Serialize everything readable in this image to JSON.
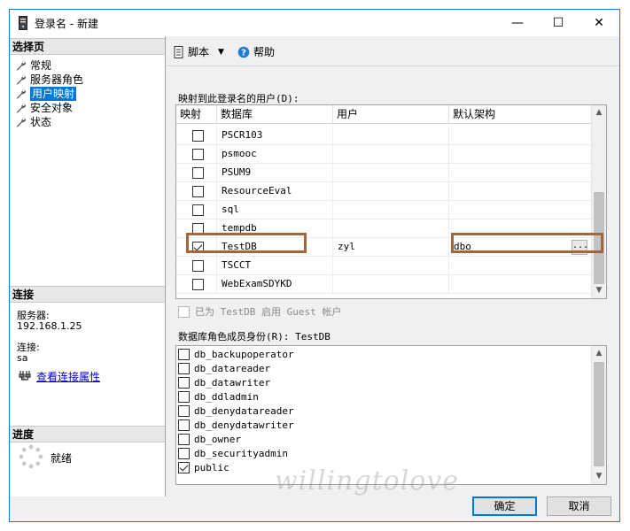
{
  "window": {
    "title": "登录名 - 新建",
    "minimize": "—",
    "maximize": "☐",
    "close": "✕"
  },
  "left_panel": {
    "select_page_header": "选择页",
    "nav_items": [
      {
        "label": "常规",
        "icon": "wrench-icon",
        "selected": false
      },
      {
        "label": "服务器角色",
        "icon": "wrench-icon",
        "selected": false
      },
      {
        "label": "用户映射",
        "icon": "wrench-icon",
        "selected": true
      },
      {
        "label": "安全对象",
        "icon": "wrench-icon",
        "selected": false
      },
      {
        "label": "状态",
        "icon": "wrench-icon",
        "selected": false
      }
    ],
    "connection_header": "连接",
    "server_label": "服务器:",
    "server_value": "192.168.1.25",
    "connection_label": "连接:",
    "connection_value": "sa",
    "view_link": "查看连接属性",
    "progress_header": "进度",
    "progress_status": "就绪"
  },
  "toolbar": {
    "script_label": "脚本",
    "help_label": "帮助"
  },
  "mapping": {
    "title": "映射到此登录名的用户(D):",
    "columns": [
      "映射",
      "数据库",
      "用户",
      "默认架构"
    ],
    "rows": [
      {
        "mapped": false,
        "database": "PSCR103",
        "user": "",
        "schema": ""
      },
      {
        "mapped": false,
        "database": "psmooc",
        "user": "",
        "schema": ""
      },
      {
        "mapped": false,
        "database": "PSUM9",
        "user": "",
        "schema": ""
      },
      {
        "mapped": false,
        "database": "ResourceEval",
        "user": "",
        "schema": ""
      },
      {
        "mapped": false,
        "database": "sql",
        "user": "",
        "schema": ""
      },
      {
        "mapped": false,
        "database": "tempdb",
        "user": "",
        "schema": ""
      },
      {
        "mapped": true,
        "database": "TestDB",
        "user": "zyl",
        "schema": "dbo"
      },
      {
        "mapped": false,
        "database": "TSCCT",
        "user": "",
        "schema": ""
      },
      {
        "mapped": false,
        "database": "WebExamSDYKD",
        "user": "",
        "schema": ""
      }
    ],
    "ellipsis": "..."
  },
  "guest": {
    "label": "已为 TestDB 启用 Guest 帐户",
    "checked": false,
    "enabled": false
  },
  "roles": {
    "title": "数据库角色成员身份(R): TestDB",
    "items": [
      {
        "label": "db_backupoperator",
        "checked": false
      },
      {
        "label": "db_datareader",
        "checked": false
      },
      {
        "label": "db_datawriter",
        "checked": false
      },
      {
        "label": "db_ddladmin",
        "checked": false
      },
      {
        "label": "db_denydatareader",
        "checked": false
      },
      {
        "label": "db_denydatawriter",
        "checked": false
      },
      {
        "label": "db_owner",
        "checked": false
      },
      {
        "label": "db_securityadmin",
        "checked": false
      },
      {
        "label": "public",
        "checked": true
      }
    ]
  },
  "buttons": {
    "ok": "确定",
    "cancel": "取消"
  },
  "watermark": "willingtolove",
  "colors": {
    "accent": "#0078d7",
    "highlight_box": "#a0673d",
    "link": "#0000cc"
  }
}
